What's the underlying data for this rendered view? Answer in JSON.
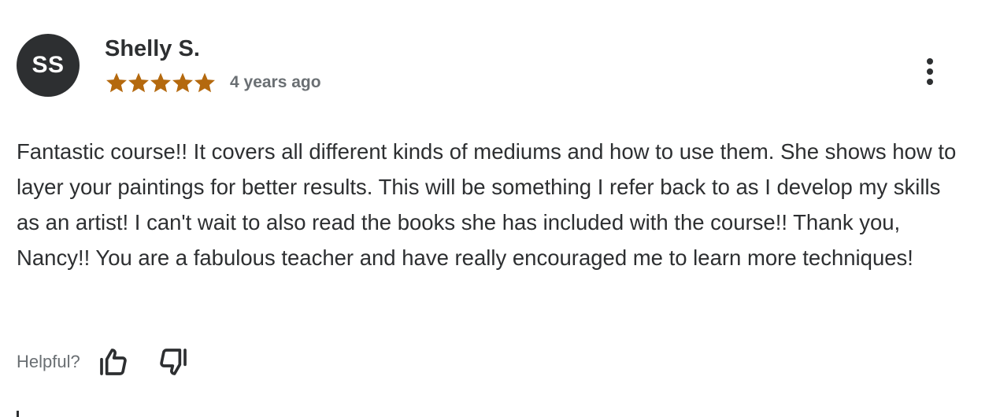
{
  "review": {
    "avatar_initials": "SS",
    "reviewer_name": "Shelly S.",
    "rating": 5,
    "rating_max": 5,
    "star_color": "#b4690e",
    "timestamp": "4 years ago",
    "more_options_icon": "vertical-dots-icon",
    "text": "Fantastic course!! It covers all different kinds of mediums and how to use them. She shows how to layer your paintings for better results. This will be something I refer back to as I develop my skills as an artist! I can't wait to also read the books she has included with the course!! Thank you, Nancy!! You are a fabulous teacher and have really encouraged me to learn more techniques!"
  },
  "feedback": {
    "helpful_label": "Helpful?",
    "thumbs_up_icon": "thumbs-up-icon",
    "thumbs_down_icon": "thumbs-down-icon"
  },
  "colors": {
    "text_primary": "#2d2f31",
    "text_secondary": "#6a6f73",
    "avatar_bg": "#2d2f31"
  }
}
